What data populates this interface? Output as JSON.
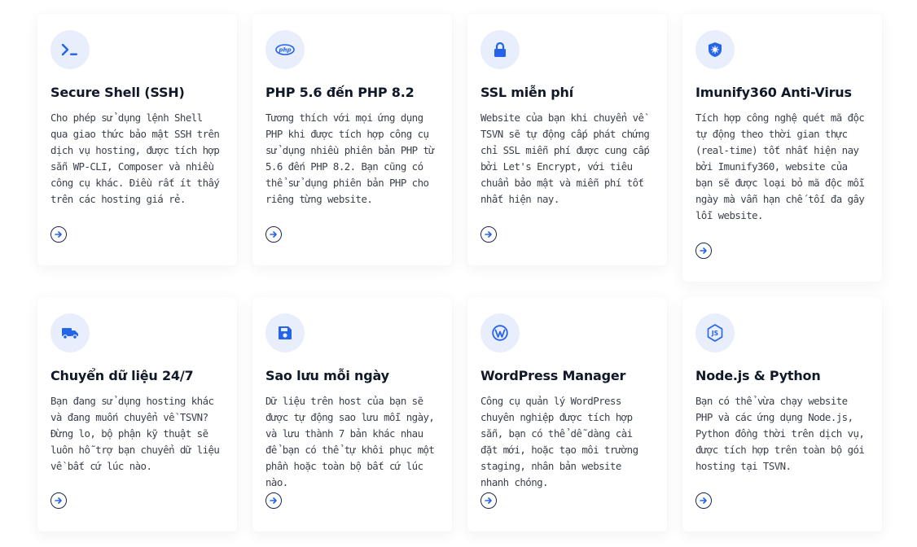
{
  "cards": [
    {
      "title": "Secure Shell (SSH)",
      "icon": "terminal-icon",
      "description": "Cho phép sử dụng lệnh Shell qua giao thức bảo mật SSH trên dịch vụ hosting, được tích hợp sẵn WP-CLI, Composer và nhiều công cụ khác. Điều rất ít thấy trên các hosting giá rẻ."
    },
    {
      "title": "PHP 5.6 đến PHP 8.2",
      "icon": "php-icon",
      "description": "Tương thích với mọi ứng dụng PHP khi được tích hợp công cụ sử dụng nhiều phiên bản PHP từ 5.6 đến PHP 8.2. Bạn cũng có thể sử dụng phiên bản PHP cho riêng từng website."
    },
    {
      "title": "SSL miễn phí",
      "icon": "lock-icon",
      "description": "Website của bạn khi chuyển về TSVN sẽ tự động cấp phát chứng chỉ SSL miễn phí được cung cấp bởi Let's Encrypt, với tiêu chuẩn bảo mật và miễn phí tốt nhất hiện nay."
    },
    {
      "title": "Imunify360 Anti-Virus",
      "icon": "shield-virus-icon",
      "description": "Tích hợp công nghệ quét mã độc tự động theo thời gian thực (real-time) tốt nhất hiện nay bởi Imunify360, website của bạn sẽ được loại bỏ mã độc mỗi ngày mà vẫn hạn chế tối đa gây lỗi website."
    },
    {
      "title": "Chuyển dữ liệu 24/7",
      "icon": "truck-icon",
      "description": "Bạn đang sử dụng hosting khác và đang muốn chuyển về TSVN? Đừng lo, bộ phận kỹ thuật sẽ luôn hỗ trợ bạn chuyển dữ liệu về bất cứ lúc nào."
    },
    {
      "title": "Sao lưu mỗi ngày",
      "icon": "floppy-disk-icon",
      "description": "Dữ liệu trên host của bạn sẽ được tự động sao lưu mỗi ngày, và lưu thành 7 bản khác nhau để bạn có thể tự khôi phục một phần hoặc toàn bộ bất cứ lúc nào."
    },
    {
      "title": "WordPress Manager",
      "icon": "wordpress-icon",
      "description": "Công cụ quản lý WordPress chuyên nghiệp được tích hợp sẵn, bạn có thể dễ dàng cài đặt mới, hoặc tạo môi trường staging, nhân bản website nhanh chóng."
    },
    {
      "title": "Node.js & Python",
      "icon": "nodejs-icon",
      "description": "Bạn có thể vừa chạy website PHP và các ứng dụng Node.js, Python đồng thời trên dịch vụ, được tích hợp trên toàn bộ gói hosting tại TSVN."
    }
  ],
  "colors": {
    "accent": "#2563eb",
    "icon_bg": "#e8eefb",
    "title": "#111827",
    "text": "#3a3f4a",
    "arrow": "#1b2a4a"
  }
}
